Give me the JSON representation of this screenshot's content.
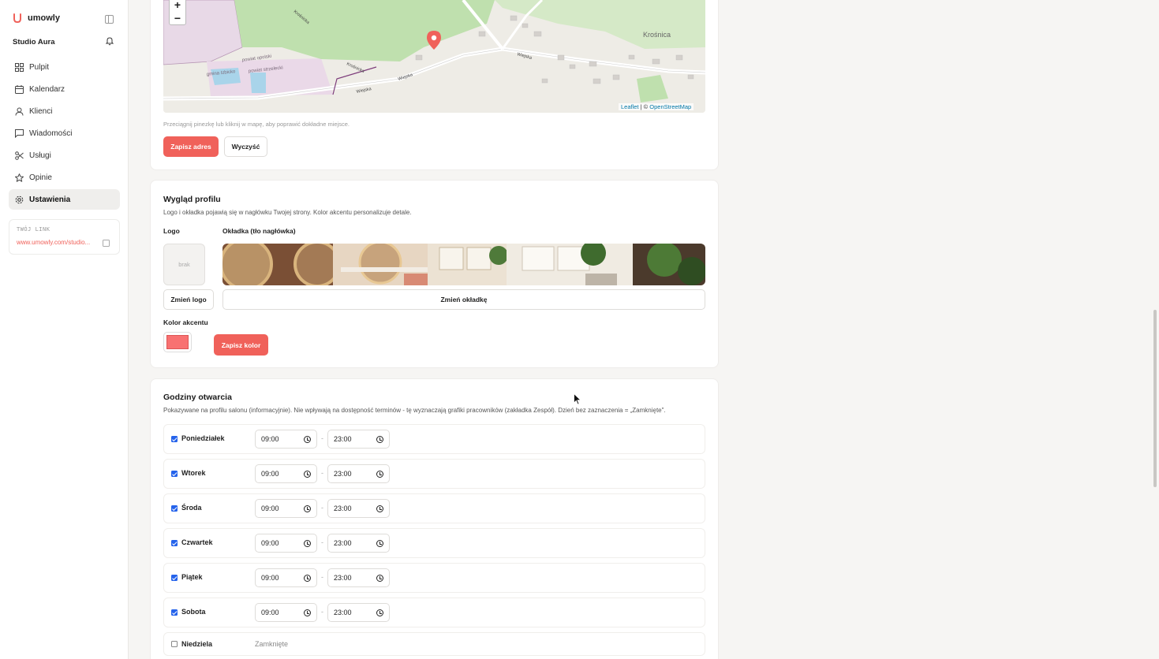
{
  "brand": {
    "name": "umowly",
    "studio": "Studio Aura"
  },
  "nav": [
    {
      "label": "Pulpit",
      "icon": "grid-icon"
    },
    {
      "label": "Kalendarz",
      "icon": "calendar-icon"
    },
    {
      "label": "Klienci",
      "icon": "users-icon"
    },
    {
      "label": "Wiadomości",
      "icon": "message-icon"
    },
    {
      "label": "Usługi",
      "icon": "scissors-icon"
    },
    {
      "label": "Opinie",
      "icon": "star-icon"
    },
    {
      "label": "Ustawienia",
      "icon": "gear-icon",
      "active": true
    }
  ],
  "link": {
    "label": "TWÓJ LINK",
    "url": "www.umowly.com/studio..."
  },
  "map": {
    "zoom_in": "+",
    "zoom_out": "−",
    "town": "Krośnica",
    "roads": [
      "Wiejska",
      "Wiejska",
      "Wiejska",
      "Krośnicka",
      "Krośnicka"
    ],
    "areas": [
      "powiat opolski",
      "gmina Izbicko",
      "powiat strzelecki"
    ],
    "attribution_leaflet": "Leaflet",
    "attribution_sep": " | © ",
    "attribution_osm": "OpenStreetMap",
    "hint": "Przeciągnij pinezkę lub kliknij w mapę, aby poprawić dokładne miejsce.",
    "save_label": "Zapisz adres",
    "clear_label": "Wyczyść"
  },
  "profile": {
    "title": "Wygląd profilu",
    "description": "Logo i okładka pojawią się w nagłówku Twojej strony. Kolor akcentu personalizuje detale.",
    "logo_label": "Logo",
    "logo_placeholder": "brak",
    "change_logo": "Zmień logo",
    "cover_label": "Okładka (tło nagłówka)",
    "change_cover": "Zmień okładkę",
    "accent_label": "Kolor akcentu",
    "accent_color": "#f87171",
    "save_color": "Zapisz kolor"
  },
  "hours": {
    "title": "Godziny otwarcia",
    "description": "Pokazywane na profilu salonu (informacyjnie). Nie wpływają na dostępność terminów - tę wyznaczają grafiki pracowników (zakładka Zespół). Dzień bez zaznaczenia = „Zamknięte\".",
    "separator": "-",
    "days": [
      {
        "name": "Poniedziałek",
        "open": true,
        "from": "09:00",
        "to": "23:00"
      },
      {
        "name": "Wtorek",
        "open": true,
        "from": "09:00",
        "to": "23:00"
      },
      {
        "name": "Środa",
        "open": true,
        "from": "09:00",
        "to": "23:00"
      },
      {
        "name": "Czwartek",
        "open": true,
        "from": "09:00",
        "to": "23:00"
      },
      {
        "name": "Piątek",
        "open": true,
        "from": "09:00",
        "to": "23:00"
      },
      {
        "name": "Sobota",
        "open": true,
        "from": "09:00",
        "to": "23:00"
      },
      {
        "name": "Niedziela",
        "open": false,
        "closed_label": "Zamknięte"
      }
    ]
  },
  "colors": {
    "accent": "#f0615a",
    "checkbox": "#2563eb"
  }
}
